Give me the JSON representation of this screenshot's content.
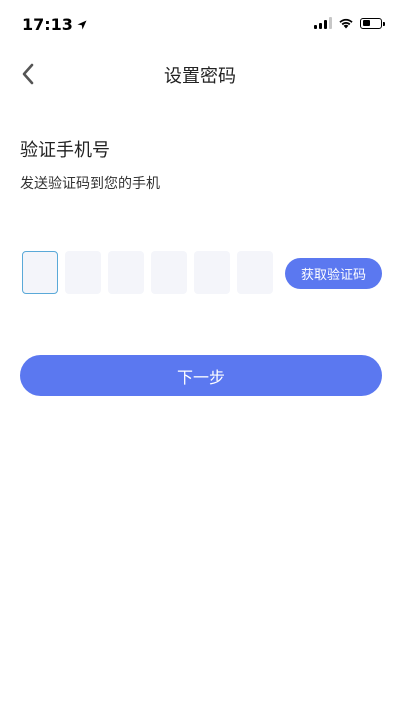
{
  "status_bar": {
    "time": "17:13",
    "battery_level": 0.45
  },
  "nav": {
    "title": "设置密码"
  },
  "content": {
    "title": "验证手机号",
    "subtitle": "发送验证码到您的手机"
  },
  "code_input": {
    "digits": [
      "",
      "",
      "",
      "",
      "",
      ""
    ],
    "get_code_label": "获取验证码"
  },
  "actions": {
    "next_label": "下一步"
  },
  "colors": {
    "accent": "#5b78f0",
    "input_bg": "#f4f5fa",
    "input_focus_border": "#5aa9d8"
  }
}
